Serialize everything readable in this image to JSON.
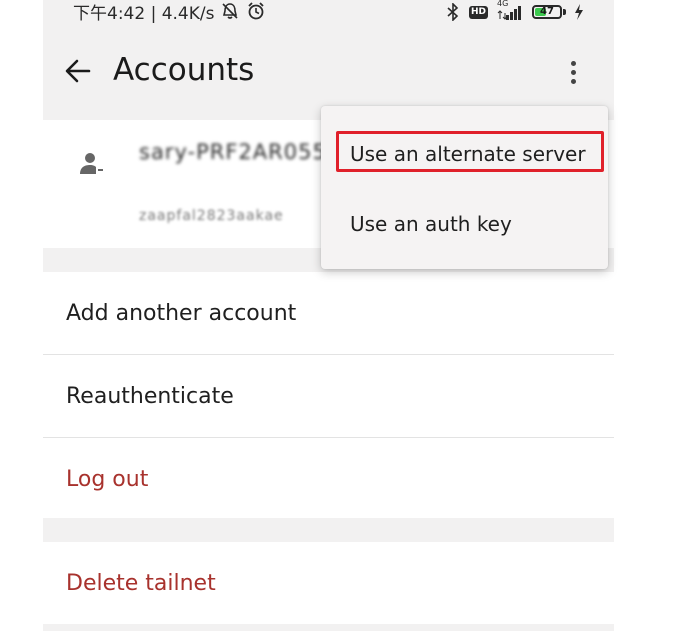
{
  "status_bar": {
    "time_speed": "下午4:42 | 4.4K/s",
    "network_label": "4G",
    "hd_label": "HD",
    "battery_level": "47",
    "battery_fraction": 0.47,
    "battery_color": "#3cc94e"
  },
  "app_bar": {
    "title": "Accounts"
  },
  "account": {
    "name": "sary-PRF2AR055",
    "subtitle": "zaapfal2823aakae"
  },
  "menu": {
    "items": [
      {
        "label": "Use an alternate server"
      },
      {
        "label": "Use an auth key"
      }
    ],
    "highlight_color": "#e0202a"
  },
  "actions": {
    "add_account": "Add another account",
    "reauthenticate": "Reauthenticate",
    "log_out": "Log out",
    "delete_tailnet": "Delete tailnet"
  },
  "colors": {
    "danger": "#a8322d",
    "background": "#f2f1f1"
  }
}
